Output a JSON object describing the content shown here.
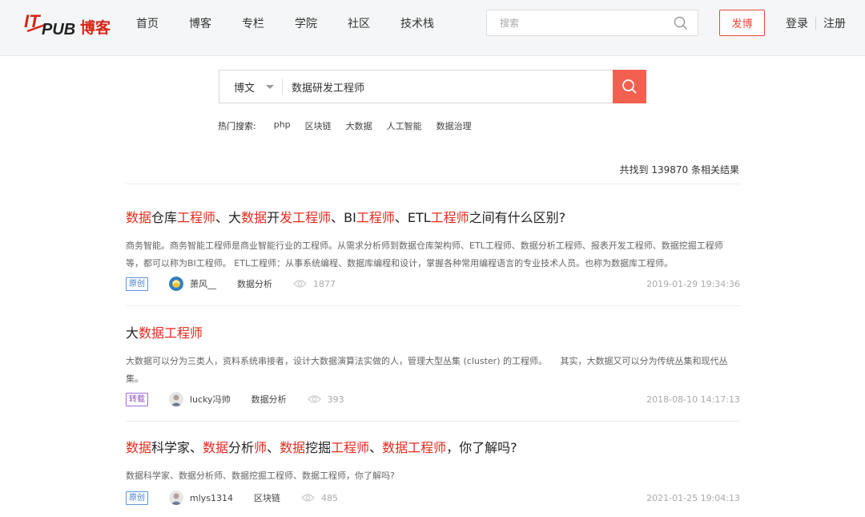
{
  "header": {
    "logo_text": "ITPUB博客",
    "nav": [
      "首页",
      "博客",
      "专栏",
      "学院",
      "社区",
      "技术栈"
    ],
    "search_placeholder": "搜索",
    "post_button": "发博",
    "login": "登录",
    "register": "注册"
  },
  "search": {
    "type": "博文",
    "query": "数据研发工程师",
    "hot_label": "热门搜索:",
    "hot_items": [
      "php",
      "区块链",
      "大数据",
      "人工智能",
      "数据治理"
    ]
  },
  "result_count": "共找到 139870 条相关结果",
  "results": [
    {
      "title_parts": [
        {
          "text": "数据",
          "hl": true
        },
        {
          "text": "仓库",
          "hl": false
        },
        {
          "text": "工程师",
          "hl": true
        },
        {
          "text": "、大",
          "hl": false
        },
        {
          "text": "数据",
          "hl": true
        },
        {
          "text": "开",
          "hl": false
        },
        {
          "text": "发工程师",
          "hl": true
        },
        {
          "text": "、BI",
          "hl": false
        },
        {
          "text": "工程师",
          "hl": true
        },
        {
          "text": "、ETL",
          "hl": false
        },
        {
          "text": "工程师",
          "hl": true
        },
        {
          "text": "之间有什么区别?",
          "hl": false
        }
      ],
      "desc": "商务智能。商务智能工程师是商业智能行业的工程师。从需求分析师到数据仓库架构师、ETL工程师、数据分析工程师、报表开发工程师、数据挖掘工程师等，都可以称为BI工程师。 ETL工程师：从事系统编程、数据库编程和设计，掌握各种常用编程语言的专业技术人员。也称为数据库工程师。",
      "badge": "原创",
      "author": "萧风__",
      "category": "数据分析",
      "views": "1877",
      "date": "2019-01-29 19:34:36"
    },
    {
      "title_parts": [
        {
          "text": "大",
          "hl": false
        },
        {
          "text": "数据工程师",
          "hl": true
        }
      ],
      "desc": "大数据可以分为三类人，资料系统串接者，设计大数据演算法实做的人，管理大型丛集 (cluster) 的工程师。　　其实，大数据又可以分为传统丛集和现代丛集。",
      "badge": "转载",
      "author": "lucky冯帅",
      "category": "数据分析",
      "views": "393",
      "date": "2018-08-10 14:17:13"
    },
    {
      "title_parts": [
        {
          "text": "数据",
          "hl": true
        },
        {
          "text": "科学家、",
          "hl": false
        },
        {
          "text": "数据",
          "hl": true
        },
        {
          "text": "分析",
          "hl": false
        },
        {
          "text": "师",
          "hl": true
        },
        {
          "text": "、",
          "hl": false
        },
        {
          "text": "数据",
          "hl": true
        },
        {
          "text": "挖掘",
          "hl": false
        },
        {
          "text": "工程师",
          "hl": true
        },
        {
          "text": "、",
          "hl": false
        },
        {
          "text": "数据工程师",
          "hl": true
        },
        {
          "text": "，你了解吗?",
          "hl": false
        }
      ],
      "desc": "数据科学家、数据分析师、数据挖掘工程师、数据工程师，你了解吗?",
      "badge": "原创",
      "author": "mlys1314",
      "category": "区块链",
      "views": "485",
      "date": "2021-01-25 19:04:13"
    }
  ],
  "colors": {
    "brand_red": "#e62a1f",
    "search_button": "#f2614f",
    "original_badge": "#3f7fc9",
    "repost_badge": "#8e4fcc"
  }
}
